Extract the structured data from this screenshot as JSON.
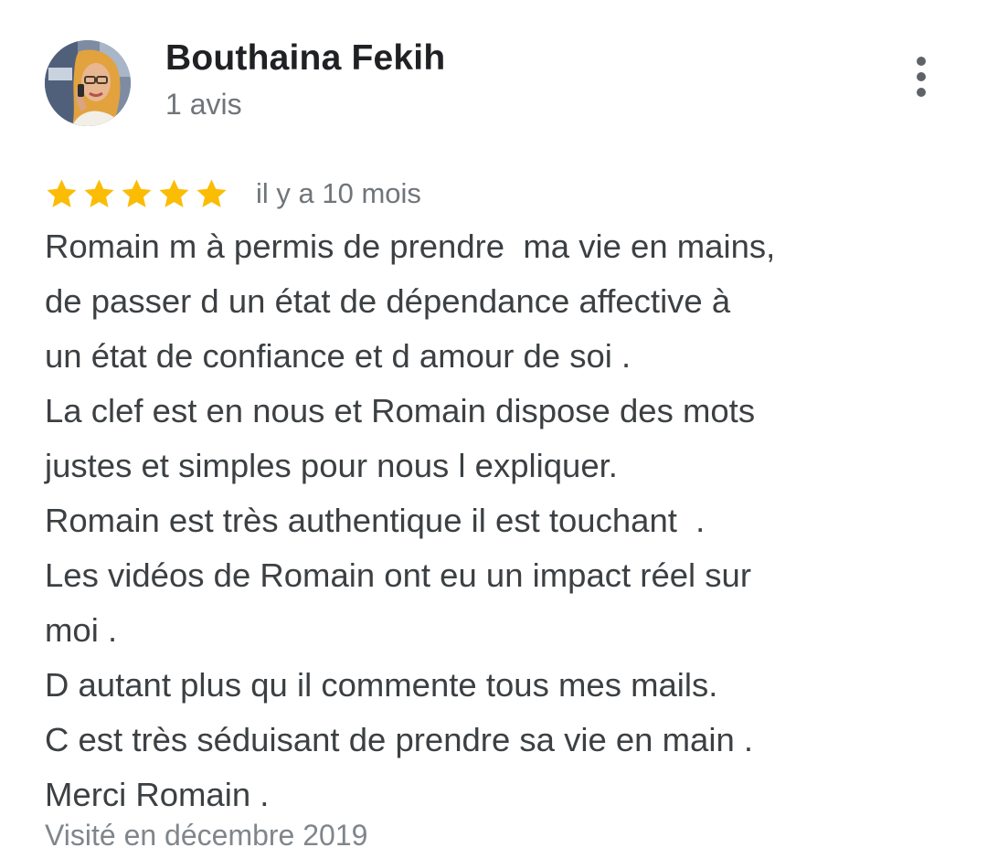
{
  "review": {
    "author_name": "Bouthaina Fekih",
    "review_count": "1 avis",
    "rating": 5,
    "rating_max": 5,
    "date": "il y a 10 mois",
    "lines": [
      "Romain m à permis de prendre  ma vie en mains,",
      "de passer d un état de dépendance affective à",
      "un état de confiance et d amour de soi .",
      "La clef est en nous et Romain dispose des mots",
      "justes et simples pour nous l expliquer.",
      "Romain est très authentique il est touchant  .",
      "Les vidéos de Romain ont eu un impact réel sur",
      "moi .",
      "D autant plus qu il commente tous mes mails.",
      "C est très séduisant de prendre sa vie en main .",
      "Merci Romain ."
    ],
    "visited": "Visité en décembre 2019"
  },
  "icons": {
    "menu": "more-vert-icon",
    "star": "star-icon"
  },
  "colors": {
    "star": "#fbbc04",
    "name": "#202124",
    "body_text": "#3c4043",
    "secondary_text": "#70757a",
    "menu_dots": "#5f6368"
  }
}
